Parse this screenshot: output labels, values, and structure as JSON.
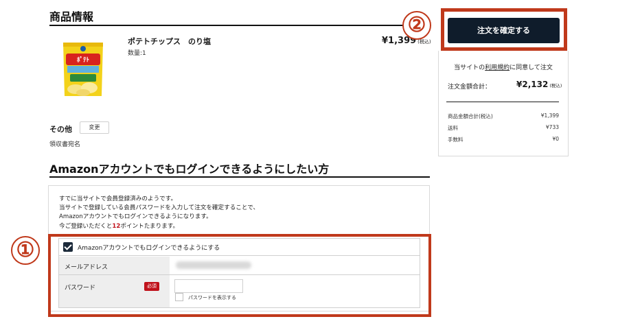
{
  "product_section": {
    "title": "商品情報",
    "item": {
      "name": "ポテトチップス　のり塩",
      "quantity": "数量:1",
      "price": "¥1,399",
      "price_note": "(税込)"
    }
  },
  "other": {
    "label": "その他",
    "change_button": "変更",
    "receipt_label": "領収書宛名"
  },
  "amazon_section": {
    "title": "Amazonアカウントでもログインできるようにしたい方",
    "intro_lines": [
      "すでに当サイトで会員登録済みのようです。",
      "当サイトで登録している会員パスワードを入力して注文を確定することで、",
      "Amazonアカウントでもログインできるようになります。"
    ],
    "points_prefix": "今ご登録いただくと",
    "points_value": "12",
    "points_suffix": "ポイントたまります。",
    "checkbox_label": "Amazonアカウントでもログインできるようにする",
    "checkbox_checked": true,
    "email_label": "メールアドレス",
    "password_label": "パスワード",
    "required_badge": "必須",
    "show_password_label": "パスワードを表示する"
  },
  "badges": {
    "one": "①",
    "two": "②"
  },
  "summary": {
    "confirm_button": "注文を確定する",
    "agree_prefix": "当サイトの",
    "agree_link": "利用規約",
    "agree_suffix": "に同意して注文",
    "total_label": "注文金額合計：",
    "total_value": "¥2,132",
    "total_note": "(税込)",
    "lines": [
      {
        "label": "商品金額合計(税込)",
        "value": "¥1,399"
      },
      {
        "label": "送料",
        "value": "¥733"
      },
      {
        "label": "手数料",
        "value": "¥0"
      }
    ]
  },
  "colors": {
    "accent_red": "#c0391b",
    "button_navy": "#0f1c2b",
    "points_red": "#c0121b"
  }
}
